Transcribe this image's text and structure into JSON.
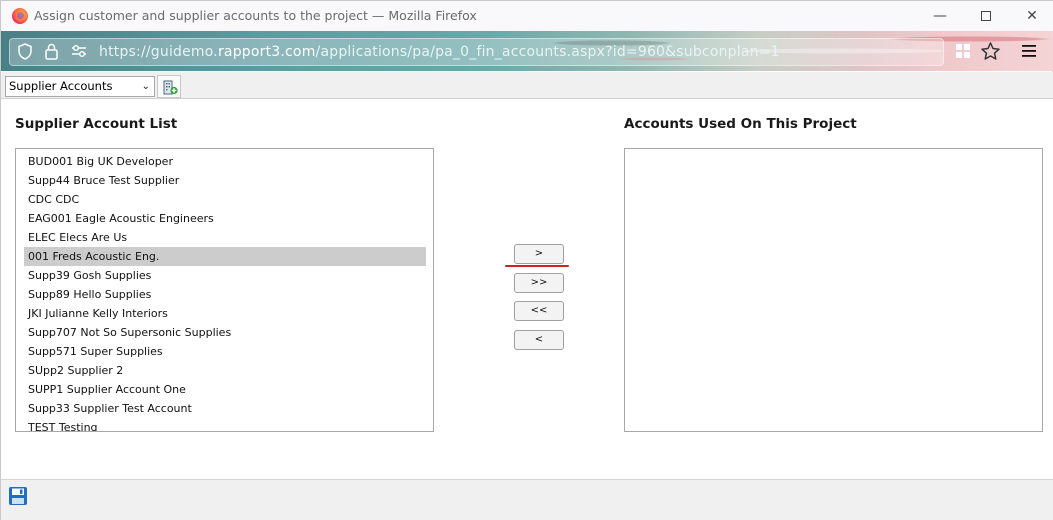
{
  "window": {
    "title": "Assign customer and supplier accounts to the project — Mozilla Firefox",
    "minimize_glyph": "—",
    "close_glyph": "✕"
  },
  "browser": {
    "url_prefix": "https://guidemo.",
    "url_domain": "rapport3.com",
    "url_path": "/applications/pa/pa_0_fin_accounts.aspx?id=960&subconplan=1",
    "icons": [
      "shield-icon",
      "lock-icon",
      "permissions-icon",
      "extensions-grid-icon",
      "bookmark-star-icon",
      "hamburger-menu-icon"
    ]
  },
  "toolbar": {
    "account_type_select": {
      "selected": "Supplier Accounts",
      "chevron": "⌄"
    },
    "add_icon": "add-building-icon"
  },
  "left_panel": {
    "heading": "Supplier Account List",
    "items": [
      "BUD001 Big UK Developer",
      "Supp44 Bruce Test Supplier",
      "CDC CDC",
      "EAG001 Eagle Acoustic Engineers",
      "ELEC Elecs Are Us",
      "001 Freds Acoustic Eng.",
      "Supp39 Gosh Supplies",
      "Supp89 Hello Supplies",
      "JKI Julianne Kelly Interiors",
      "Supp707 Not So Supersonic Supplies",
      "Supp571 Super Supplies",
      "SUpp2 Supplier 2",
      "SUPP1 Supplier Account One",
      "Supp33 Supplier Test Account",
      "TEST Testing"
    ],
    "selected_item": "001 Freds Acoustic Eng."
  },
  "right_panel": {
    "heading": "Accounts Used On This Project",
    "items": []
  },
  "move_buttons": {
    "add_selected": ">",
    "add_all": ">>",
    "remove_all": "<<",
    "remove_selected": "<"
  },
  "footer": {
    "save_icon": "floppy-disk-save-icon"
  },
  "colors": {
    "selected_row": "#cccccc",
    "annotation_underline": "#d32020",
    "save_icon_blue": "#1e6fc0"
  }
}
